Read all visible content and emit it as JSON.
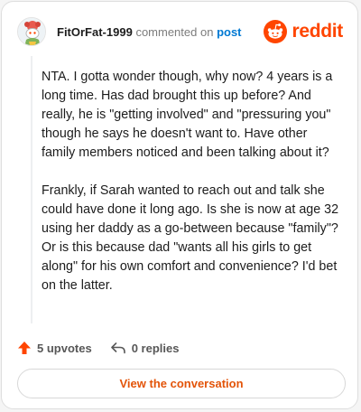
{
  "header": {
    "username": "FitOrFat-1999",
    "commented_text": "commented on",
    "post_link": "post",
    "brand": "reddit"
  },
  "comment": {
    "paragraphs": [
      "NTA. I gotta wonder though, why now? 4 years is a long time. Has dad brought this up before? And really, he is \"getting involved\" and \"pressuring you\" though he says he doesn't want to. Have other family members noticed and been talking about it?",
      "Frankly, if Sarah wanted to reach out and talk she could have done it long ago. Is she is now at age 32 using her daddy as a go-between because \"family\"? Or is this because dad \"wants all his girls to get along\" for his own comfort and convenience? I'd bet on the latter."
    ]
  },
  "actions": {
    "upvotes": "5 upvotes",
    "replies": "0 replies"
  },
  "cta": {
    "label": "View the conversation"
  },
  "colors": {
    "brand": "#ff4500",
    "upvote": "#ff4500",
    "link": "#0079d3",
    "cta_text": "#e35409"
  },
  "icons": {
    "avatar": "snoo-avatar-icon",
    "logo": "reddit-logo-icon",
    "upvote": "upvote-arrow-icon",
    "reply": "reply-arrow-icon"
  }
}
